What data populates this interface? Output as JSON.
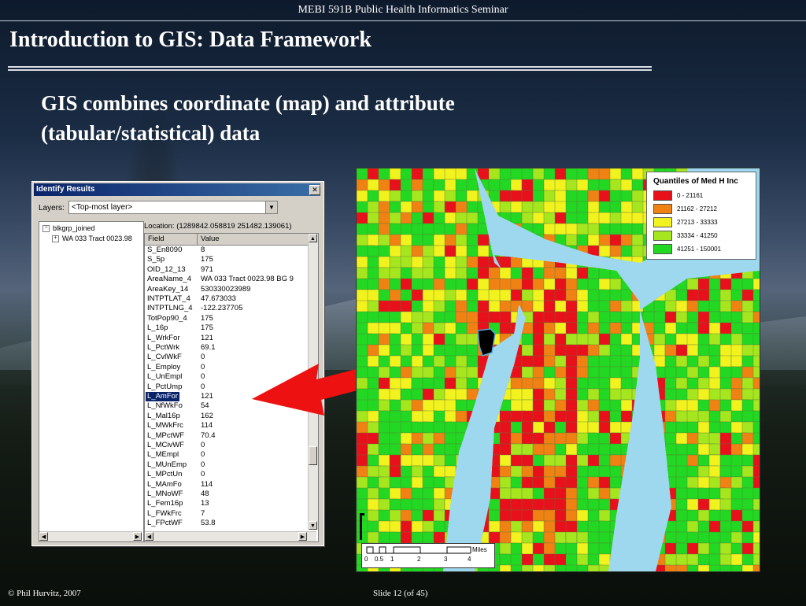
{
  "header": {
    "seminar": "MEBI 591B Public Health Informatics Seminar",
    "title": "Introduction to GIS: Data Framework",
    "subtitle": "GIS combines coordinate (map) and attribute (tabular/statistical) data"
  },
  "identify": {
    "window_title": "Identify Results",
    "close_glyph": "✕",
    "layers_label": "Layers:",
    "layers_value": "<Top-most layer>",
    "tree_root": "blkgrp_joined",
    "tree_child": "WA 033 Tract 0023.98",
    "location": "Location: (1289842.058819 251482.139061)",
    "columns": [
      "Field",
      "Value"
    ],
    "rows": [
      [
        "S_En8090",
        "8"
      ],
      [
        "S_5p",
        "175"
      ],
      [
        "OID_12_13",
        "971"
      ],
      [
        "AreaName_4",
        "WA 033 Tract 0023.98 BG 9"
      ],
      [
        "AreaKey_14",
        "530330023989"
      ],
      [
        "INTPTLAT_4",
        "47.673033"
      ],
      [
        "INTPTLNG_4",
        "-122.237705"
      ],
      [
        "TotPop90_4",
        "175"
      ],
      [
        "L_16p",
        "175"
      ],
      [
        "L_WrkFor",
        "121"
      ],
      [
        "L_PctWrk",
        "69.1"
      ],
      [
        "L_CvlWkF",
        "0"
      ],
      [
        "L_Employ",
        "0"
      ],
      [
        "L_UnEmpl",
        "0"
      ],
      [
        "L_PctUmp",
        "0"
      ],
      [
        "L_AmFor",
        "121"
      ],
      [
        "L_NfWkFo",
        "54"
      ],
      [
        "L_Mal16p",
        "162"
      ],
      [
        "L_MWkFrc",
        "114"
      ],
      [
        "L_MPctWF",
        "70.4"
      ],
      [
        "L_MCivWF",
        "0"
      ],
      [
        "L_MEmpl",
        "0"
      ],
      [
        "L_MUnEmp",
        "0"
      ],
      [
        "L_MPctUn",
        "0"
      ],
      [
        "L_MAmFo",
        "114"
      ],
      [
        "L_MNoWF",
        "48"
      ],
      [
        "L_Fem16p",
        "13"
      ],
      [
        "L_FWkFrc",
        "7"
      ],
      [
        "L_FPctWF",
        "53.8"
      ]
    ],
    "highlighted_row": 15
  },
  "map": {
    "legend_title": "Quantiles of Med H Inc",
    "legend": [
      {
        "label": "0 - 21161",
        "color": "#e8101a"
      },
      {
        "label": "21162 - 27212",
        "color": "#f08214"
      },
      {
        "label": "27213 - 33333",
        "color": "#f2f21e"
      },
      {
        "label": "33334 - 41250",
        "color": "#a6e61e"
      },
      {
        "label": "41251 - 150001",
        "color": "#22d822"
      }
    ],
    "water_color": "#9ed8ef",
    "scale_numbers": [
      "0",
      "0.5",
      "1",
      "2",
      "3",
      "4"
    ],
    "scale_unit": "Miles"
  },
  "arrow_color": "#ee1111",
  "footer": {
    "copyright": "© Phil Hurvitz, 2007",
    "slide": "Slide  12 (of  45)"
  }
}
